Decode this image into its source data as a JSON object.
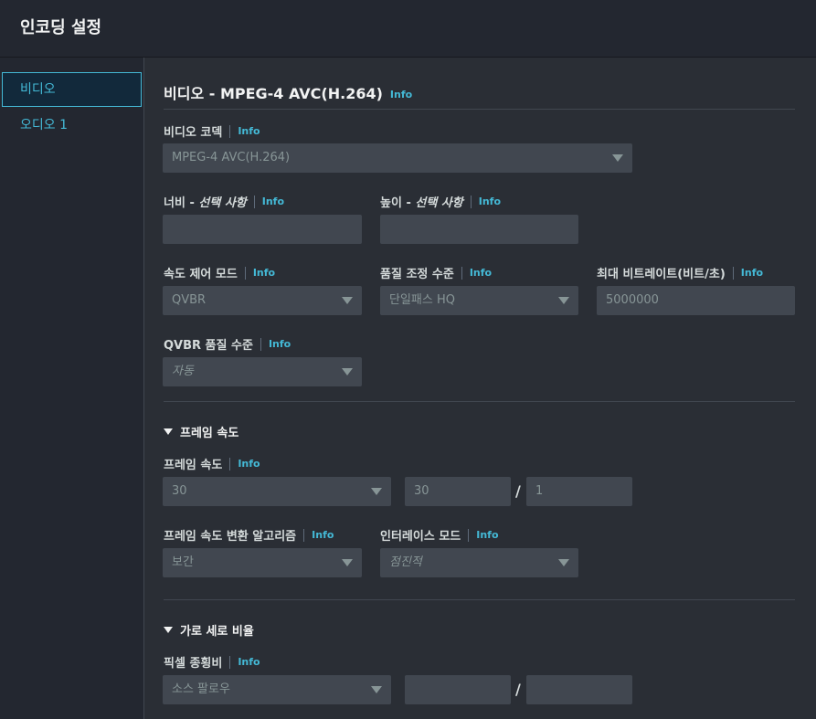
{
  "header": {
    "title": "인코딩 설정"
  },
  "sidebar": {
    "items": [
      {
        "label": "비디오"
      },
      {
        "label": "오디오 1"
      }
    ]
  },
  "info_label": "Info",
  "video": {
    "section_title": "비디오 - MPEG-4 AVC(H.264)",
    "codec": {
      "label": "비디오 코덱",
      "value": "MPEG-4 AVC(H.264)"
    },
    "width": {
      "label": "너비 - ",
      "optional": "선택 사항",
      "value": ""
    },
    "height": {
      "label": "높이 - ",
      "optional": "선택 사항",
      "value": ""
    },
    "rate_control": {
      "label": "속도 제어 모드",
      "value": "QVBR"
    },
    "quality_tuning": {
      "label": "품질 조정 수준",
      "value": "단일패스 HQ"
    },
    "max_bitrate": {
      "label": "최대 비트레이트(비트/초)",
      "placeholder": "5000000"
    },
    "qvbr_quality": {
      "label": "QVBR 품질 수준",
      "value": "자동"
    }
  },
  "framerate": {
    "section_title": "프레임 속도",
    "framerate": {
      "label": "프레임 속도",
      "value": "30",
      "numerator": "30",
      "denominator": "1"
    },
    "conversion": {
      "label": "프레임 속도 변환 알고리즘",
      "value": "보간"
    },
    "interlace": {
      "label": "인터레이스 모드",
      "value": "점진적"
    }
  },
  "aspect": {
    "section_title": "가로 세로 비율",
    "par": {
      "label": "픽셀 종횡비",
      "value": "소스 팔로우",
      "numerator": "",
      "denominator": ""
    }
  },
  "slash": "/"
}
